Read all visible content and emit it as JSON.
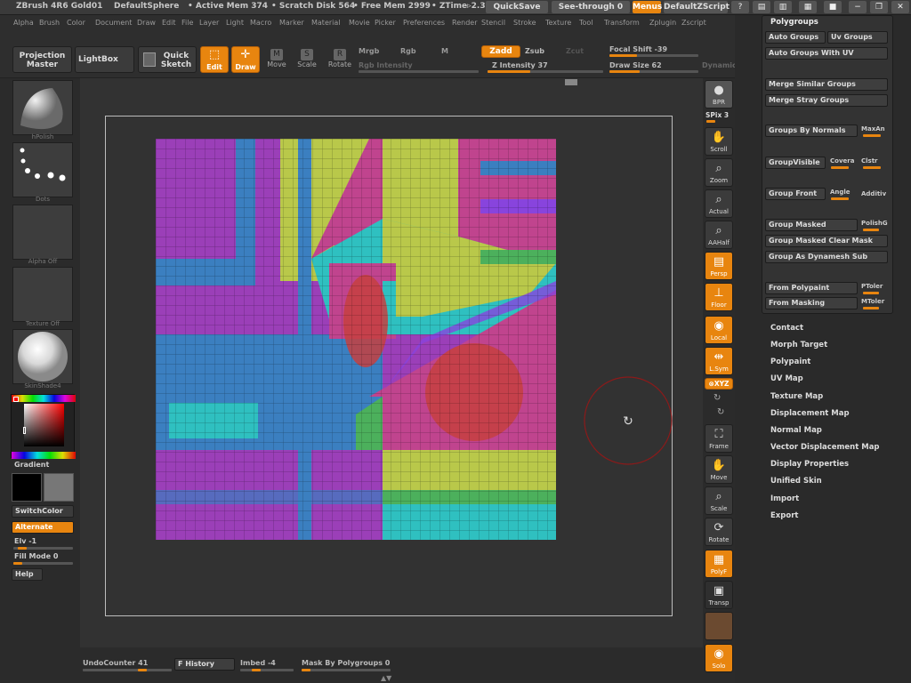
{
  "topbar": {
    "app": "ZBrush 4R6 Gold01",
    "doc": "DefaultSphere",
    "active_mem": "• Active Mem 374",
    "scratch": "• Scratch Disk 564",
    "free_mem": "• Free Mem 2999",
    "ztime": "• ZTime▹2.3",
    "quicksave": "QuickSave",
    "seethrough": "See-through   0",
    "menus": "Menus",
    "zscript": "DefaultZScript"
  },
  "menubar": [
    "Alpha",
    "Brush",
    "Color",
    "Document",
    "Draw",
    "Edit",
    "File",
    "Layer",
    "Light",
    "Macro",
    "Marker",
    "Material",
    "Movie",
    "Picker",
    "Preferences",
    "Render",
    "Stencil",
    "Stroke",
    "Texture",
    "Tool",
    "Transform",
    "Zplugin",
    "Zscript"
  ],
  "toolbar": {
    "projection_master": "Projection Master",
    "lightbox": "LightBox",
    "quick_sketch": "Quick Sketch",
    "edit": "Edit",
    "draw": "Draw",
    "move": "Move",
    "scale": "Scale",
    "rotate": "Rotate",
    "mrgb": "Mrgb",
    "rgb": "Rgb",
    "m": "M",
    "rgb_intensity": "Rgb Intensity",
    "zadd": "Zadd",
    "zsub": "Zsub",
    "zcut": "Zcut",
    "z_intensity": "Z Intensity 37",
    "focal_shift": "Focal Shift -39",
    "draw_size": "Draw Size 62",
    "dynamic": "Dynamic",
    "z_intensity_value": 0.37,
    "focal_shift_value": -0.39,
    "draw_size_value": 0.62
  },
  "left": {
    "brush_label": "hPolish",
    "stroke_label": "Dots",
    "alpha_label": "Alpha Off",
    "texture_label": "Texture Off",
    "material_label": "SkinShade4",
    "gradient": "Gradient",
    "switchcolor": "SwitchColor",
    "alternate": "Alternate",
    "elv": "Elv -1",
    "fill_mode": "Fill Mode 0",
    "help": "Help"
  },
  "right": {
    "bpr": "BPR",
    "spix": "SPix 3",
    "scroll": "Scroll",
    "zoom": "Zoom",
    "actual": "Actual",
    "aahalf": "AAHalf",
    "persp": "Persp",
    "floor": "Floor",
    "local": "Local",
    "lsym": "L.Sym",
    "xyz": "⊗XYZ",
    "frame": "Frame",
    "move": "Move",
    "scale": "Scale",
    "rotate": "Rotate",
    "polyf": "PolyF",
    "transp": "Transp",
    "solo": "Solo"
  },
  "polygroups": {
    "title": "Polygroups",
    "auto_groups": "Auto Groups",
    "uv_groups": "Uv Groups",
    "auto_groups_uv": "Auto Groups With UV",
    "merge_similar": "Merge Similar Groups",
    "merge_stray": "Merge Stray Groups",
    "group_by_normals": "Groups By Normals",
    "maxangle": "MaxAn",
    "group_visible": "GroupVisible",
    "coverage": "Covera",
    "clustering": "Clstr",
    "group_front": "Group Front",
    "angle": "Angle",
    "additive": "Additiv",
    "group_masked": "Group Masked",
    "polish": "PolishG",
    "group_masked_clear": "Group Masked Clear Mask",
    "group_as_dynamesh": "Group As Dynamesh Sub",
    "from_polypaint": "From Polypaint",
    "ptolerance": "PToler",
    "from_masking": "From Masking",
    "mtolerance": "MToler"
  },
  "submenus": [
    "Contact",
    "Morph Target",
    "Polypaint",
    "UV Map",
    "Texture Map",
    "Displacement Map",
    "Normal Map",
    "Vector Displacement Map",
    "Display Properties",
    "Unified Skin",
    "Import",
    "Export"
  ],
  "bottom": {
    "undo": "UndoCounter 41",
    "history": "F History",
    "imbed": "Imbed -4",
    "mask_by_pg": "Mask By Polygroups 0"
  },
  "colors": {
    "accent": "#e8850f",
    "purple": "#9b3fb8",
    "blue": "#3b7fc0",
    "lime": "#b9c84a",
    "pink": "#c0448e",
    "cyan": "#2fc0c0",
    "red": "#c54040",
    "green": "#4cb05c",
    "violet": "#8844dd"
  }
}
